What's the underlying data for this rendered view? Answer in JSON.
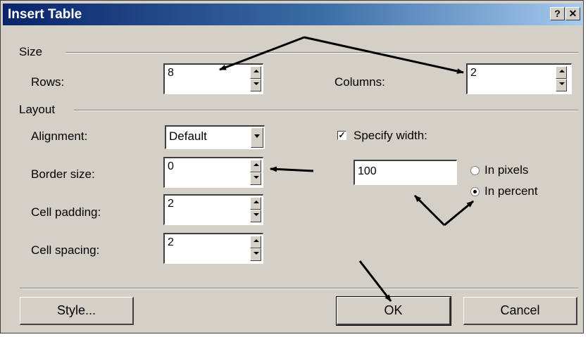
{
  "dialog": {
    "title": "Insert Table",
    "help_label": "?",
    "close_label": "✕"
  },
  "size": {
    "group_label": "Size",
    "rows_label": "Rows:",
    "rows_value": "8",
    "columns_label": "Columns:",
    "columns_value": "2"
  },
  "layout": {
    "group_label": "Layout",
    "alignment_label": "Alignment:",
    "alignment_value": "Default",
    "border_label": "Border size:",
    "border_value": "0",
    "padding_label": "Cell padding:",
    "padding_value": "2",
    "spacing_label": "Cell spacing:",
    "spacing_value": "2",
    "specify_width_label": "Specify width:",
    "specify_width_checked": true,
    "width_value": "100",
    "in_pixels_label": "In pixels",
    "in_percent_label": "In percent",
    "selected_unit": "In percent"
  },
  "buttons": {
    "style_label": "Style...",
    "ok_label": "OK",
    "cancel_label": "Cancel"
  }
}
